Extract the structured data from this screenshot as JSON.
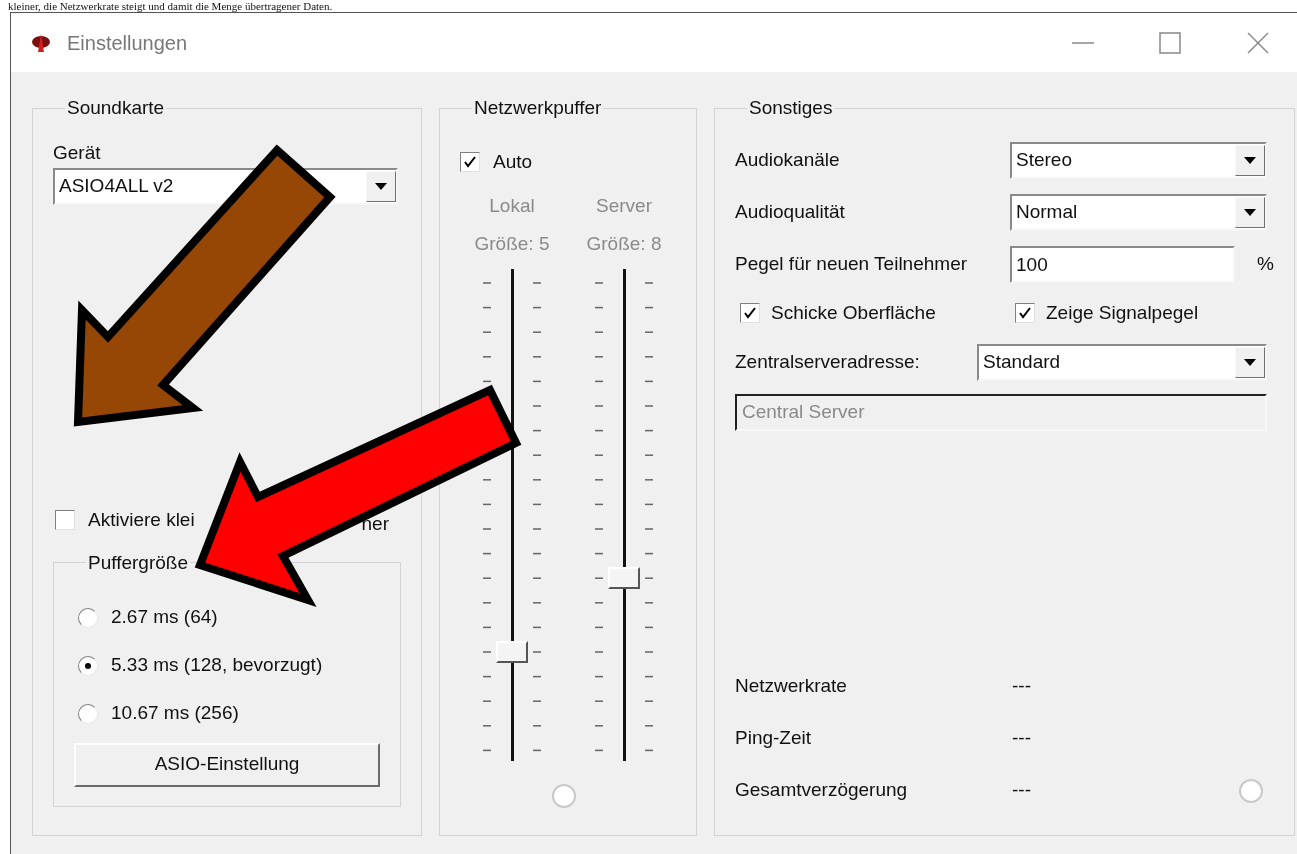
{
  "caption": "kleiner, die Netzwerkrate steigt und damit die Menge übertragener Daten.",
  "window": {
    "title": "Einstellungen"
  },
  "soundcard": {
    "title": "Soundkarte",
    "device_label": "Gerät",
    "device": "ASIO4ALL v2",
    "small_buffers": {
      "label_start": "Aktiviere klei",
      "label_end": "ner",
      "checked": false
    },
    "buffer_size": {
      "title": "Puffergröße",
      "options": [
        {
          "label": "2.67 ms (64)",
          "selected": false
        },
        {
          "label": "5.33 ms (128, bevorzugt)",
          "selected": true
        },
        {
          "label": "10.67 ms (256)",
          "selected": false
        }
      ]
    },
    "asio_button": "ASIO-Einstellung"
  },
  "network_buffer": {
    "title": "Netzwerkpuffer",
    "auto": {
      "label": "Auto",
      "checked": true
    },
    "sliders": [
      {
        "label": "Lokal",
        "size": "Größe: 5",
        "level": 0.22
      },
      {
        "label": "Server",
        "size": "Größe: 8",
        "level": 0.37
      }
    ]
  },
  "misc": {
    "title": "Sonstiges",
    "rows": [
      {
        "kind": "dropdown",
        "label": "Audiokanäle",
        "value": "Stereo"
      },
      {
        "kind": "dropdown",
        "label": "Audioqualität",
        "value": "Normal"
      },
      {
        "kind": "input",
        "label": "Pegel für neuen Teilnehmer",
        "value": "100",
        "unit": "%"
      }
    ],
    "checkboxes": [
      {
        "label": "Schicke Oberfläche",
        "checked": true
      },
      {
        "label": "Zeige Signalpegel",
        "checked": true
      }
    ],
    "server": {
      "label": "Zentralserveradresse:",
      "value": "Standard",
      "address": "Central Server"
    },
    "stats": [
      {
        "label": "Netzwerkrate",
        "value": "---"
      },
      {
        "label": "Ping-Zeit",
        "value": "---"
      },
      {
        "label": "Gesamtverzögerung",
        "value": "---"
      }
    ]
  }
}
